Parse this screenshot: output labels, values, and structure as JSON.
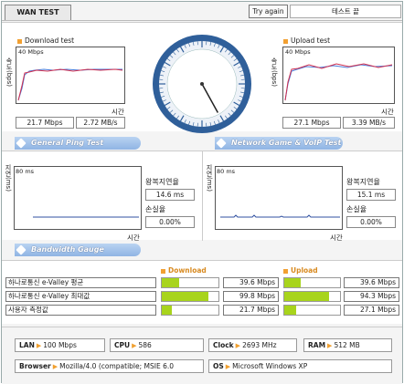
{
  "tabs": {
    "wan": "WAN TEST"
  },
  "toolbar": {
    "try_again": "Try again",
    "status": "테스트 끝"
  },
  "download": {
    "title": "Download test",
    "scale": "40 Mbps",
    "ylabel": "속도(bps)",
    "xlabel": "시간",
    "mbps": "21.7 Mbps",
    "mbs": "2.72 MB/s"
  },
  "upload": {
    "title": "Upload test",
    "scale": "40 Mbps",
    "ylabel": "속도(bps)",
    "xlabel": "시간",
    "mbps": "27.1 Mbps",
    "mbs": "3.39 MB/s"
  },
  "gauge": {
    "needle_value": 0.42
  },
  "ping": {
    "general": {
      "title": "General Ping Test",
      "scale": "80 ms",
      "ylabel": "지연(ms)",
      "xlabel": "시간",
      "rtt_label": "왕복지연율",
      "rtt": "14.6 ms",
      "loss_label": "손실율",
      "loss": "0.00%"
    },
    "game": {
      "title": "Network Game & VoIP Test",
      "scale": "80 ms",
      "ylabel": "지연(ms)",
      "xlabel": "시간",
      "rtt_label": "왕복지연율",
      "rtt": "15.1 ms",
      "loss_label": "손실율",
      "loss": "0.00%"
    }
  },
  "bandwidth": {
    "title": "Bandwidth Gauge",
    "download_label": "Download",
    "upload_label": "Upload",
    "rows": [
      {
        "label": "하나로통신 e-Valley 평균",
        "down": "39.6 Mbps",
        "down_frac": 0.3,
        "up": "39.6 Mbps",
        "up_frac": 0.3
      },
      {
        "label": "하나로통신 e-Valley 최대값",
        "down": "99.8 Mbps",
        "down_frac": 0.82,
        "up": "94.3 Mbps",
        "up_frac": 0.8
      },
      {
        "label": "사용자 측정값",
        "down": "21.7 Mbps",
        "down_frac": 0.18,
        "up": "27.1 Mbps",
        "up_frac": 0.22
      }
    ]
  },
  "system": {
    "lan_label": "LAN",
    "lan": "100 Mbps",
    "cpu_label": "CPU",
    "cpu": "586",
    "clock_label": "Clock",
    "clock": "2693 MHz",
    "ram_label": "RAM",
    "ram": "512 MB",
    "browser_label": "Browser",
    "browser": "Mozilla/4.0 (compatible; MSIE 6.0",
    "os_label": "OS",
    "os": "Microsoft Windows XP"
  },
  "colors": {
    "accent": "#f2a032",
    "ribbon": "#8fb4e4",
    "bar": "#a8d41c",
    "gauge_ring": "#2f5f9a"
  }
}
